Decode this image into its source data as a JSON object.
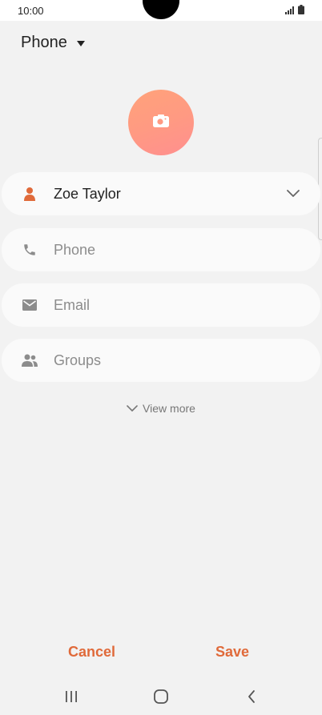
{
  "status_bar": {
    "time": "10:00",
    "icons": [
      "signal-icon",
      "battery-icon"
    ]
  },
  "account": {
    "label": "Phone"
  },
  "avatar": {
    "icon": "camera-icon",
    "gradient": [
      "#ffa27a",
      "#ff8f8f"
    ]
  },
  "fields": {
    "name": {
      "value": "Zoe Taylor",
      "icon": "person-icon"
    },
    "phone": {
      "placeholder": "Phone",
      "icon": "phone-icon"
    },
    "email": {
      "placeholder": "Email",
      "icon": "email-icon"
    },
    "groups": {
      "placeholder": "Groups",
      "icon": "groups-icon"
    }
  },
  "view_more": {
    "label": "View more"
  },
  "actions": {
    "cancel": "Cancel",
    "save": "Save"
  },
  "colors": {
    "accent": "#e06a3a",
    "background": "#f2f2f2",
    "field_background": "#fafafa"
  },
  "nav": {
    "items": [
      "recents-icon",
      "home-icon",
      "back-icon"
    ]
  }
}
